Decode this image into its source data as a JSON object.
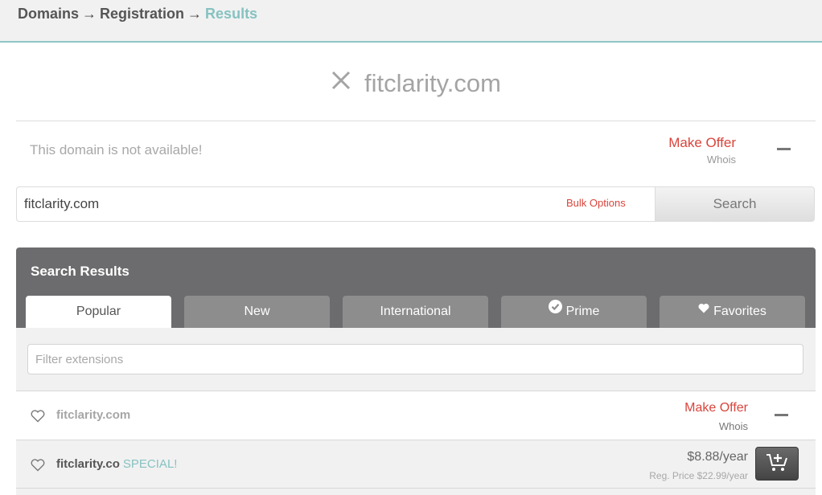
{
  "breadcrumb": {
    "items": [
      "Domains",
      "Registration",
      "Results"
    ],
    "separator": "→"
  },
  "domain_check": {
    "domain": "fitclarity.com",
    "status_icon": "close-icon",
    "status_text": "This domain is not available!",
    "make_offer_label": "Make Offer",
    "whois_label": "Whois"
  },
  "search": {
    "value": "fitclarity.com",
    "bulk_options_label": "Bulk Options",
    "button_label": "Search"
  },
  "results": {
    "title": "Search Results",
    "tabs": [
      {
        "label": "Popular",
        "icon": null,
        "active": true
      },
      {
        "label": "New",
        "icon": null,
        "active": false
      },
      {
        "label": "International",
        "icon": null,
        "active": false
      },
      {
        "label": "Prime",
        "icon": "check-circle-icon",
        "active": false
      },
      {
        "label": "Favorites",
        "icon": "heart-icon",
        "active": false
      }
    ],
    "filter_placeholder": "Filter extensions",
    "rows": [
      {
        "domain": "fitclarity.com",
        "available": false,
        "make_offer_label": "Make Offer",
        "whois_label": "Whois"
      },
      {
        "domain": "fitclarity.co",
        "badge": "SPECIAL!",
        "available": true,
        "price": "$8.88/year",
        "reg_price": "Reg. Price $22.99/year"
      }
    ]
  },
  "colors": {
    "accent_teal": "#86c2c1",
    "action_red": "#d9443b",
    "header_gray": "#6c6c6e",
    "tab_gray": "#8d8d8d"
  }
}
